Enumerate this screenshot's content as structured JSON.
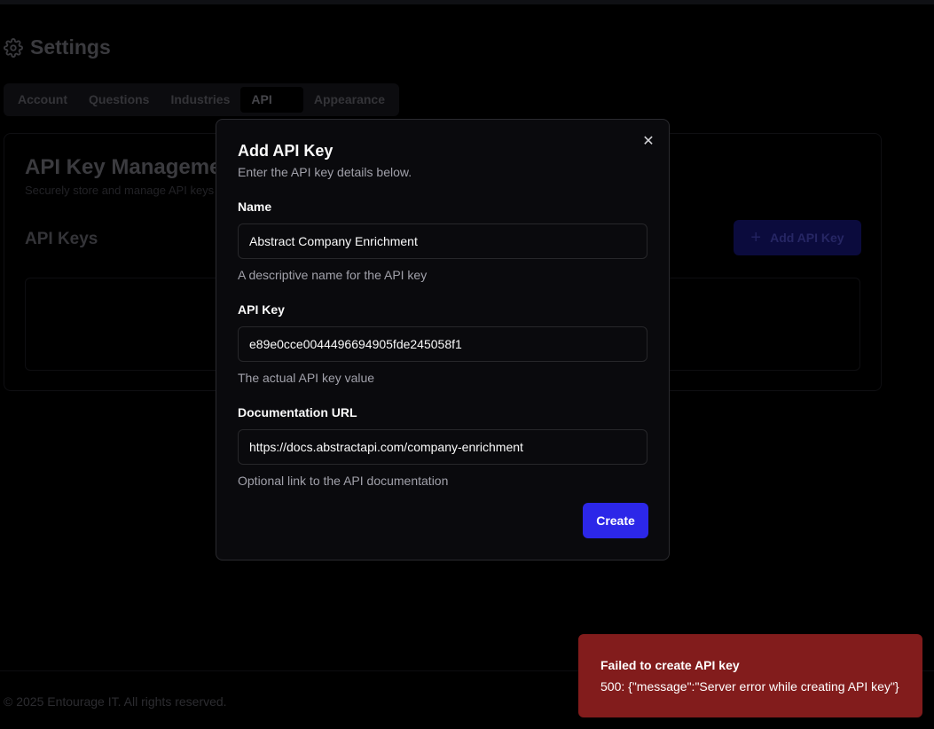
{
  "page": {
    "title": "Settings",
    "icon": "gear-icon",
    "tabs": [
      "Account",
      "Questions",
      "Industries",
      "API Keys",
      "Appearance"
    ],
    "active_tab": "API Keys",
    "card": {
      "title": "API Key Management",
      "subtitle": "Securely store and manage API keys",
      "section_title": "API Keys",
      "add_button_label": "Add API Key"
    },
    "footer": "© 2025 Entourage IT. All rights reserved."
  },
  "modal": {
    "title": "Add API Key",
    "description": "Enter the API key details below.",
    "fields": {
      "name": {
        "label": "Name",
        "value": "Abstract Company Enrichment",
        "help": "A descriptive name for the API key"
      },
      "api_key": {
        "label": "API Key",
        "value": "e89e0cce0044496694905fde245058f1",
        "help": "The actual API key value"
      },
      "doc_url": {
        "label": "Documentation URL",
        "value": "https://docs.abstractapi.com/company-enrichment",
        "help": "Optional link to the API documentation"
      }
    },
    "create_label": "Create"
  },
  "toast": {
    "title": "Failed to create API key",
    "message": "500: {\"message\":\"Server error while creating API key\"}"
  },
  "colors": {
    "accent": "#2c27e8",
    "toast_error": "#821c1c",
    "background": "#000000"
  }
}
